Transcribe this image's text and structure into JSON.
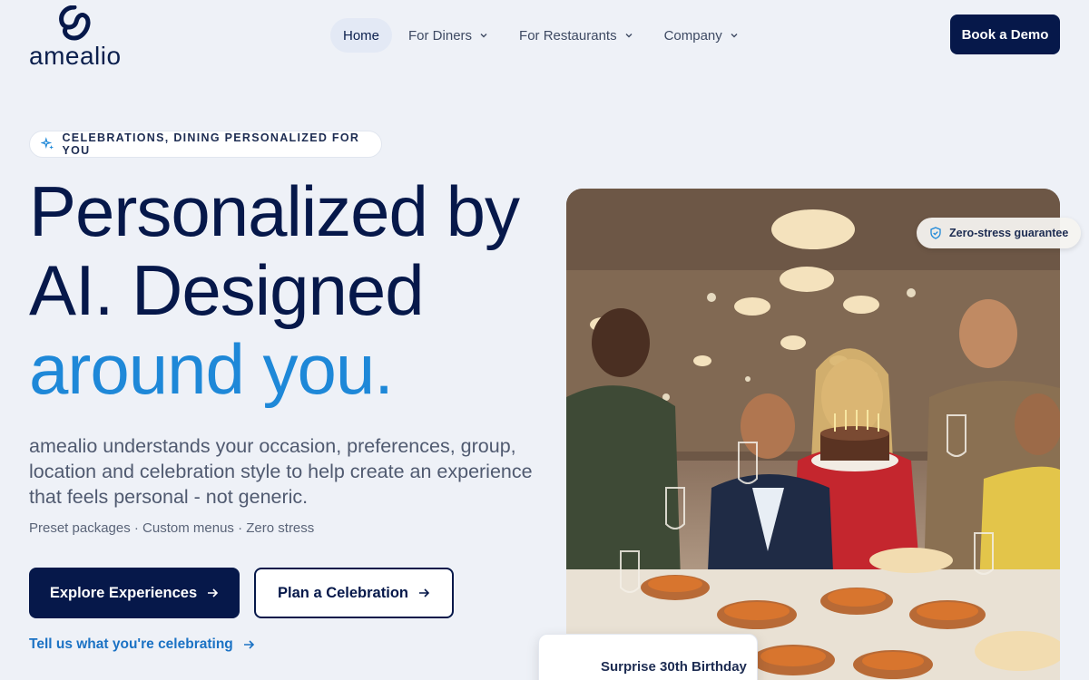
{
  "brand": {
    "name": "amealio"
  },
  "nav": {
    "items": [
      {
        "label": "Home",
        "active": true,
        "dropdown": false
      },
      {
        "label": "For Diners",
        "active": false,
        "dropdown": true
      },
      {
        "label": "For Restaurants",
        "active": false,
        "dropdown": true
      },
      {
        "label": "Company",
        "active": false,
        "dropdown": true
      }
    ],
    "cta_label": "Book a Demo"
  },
  "hero": {
    "badge": "CELEBRATIONS, DINING PERSONALIZED FOR YOU",
    "headline_line1": "Personalized by",
    "headline_line2": "AI. Designed",
    "headline_accent": "around you.",
    "description": "amealio understands your occasion, preferences, group, location and celebration style to help create an experience that feels personal - not generic.",
    "sub": "Preset packages · Custom menus · Zero stress",
    "primary_label": "Explore Experiences",
    "secondary_label": "Plan a Celebration",
    "link_label": "Tell us what you're celebrating"
  },
  "photo": {
    "guarantee_badge": "Zero-stress guarantee",
    "card_title": "Surprise 30th Birthday"
  },
  "colors": {
    "navy": "#06184a",
    "accent_blue": "#1e88d8",
    "link_blue": "#1b72c4",
    "background": "#eef1f7"
  },
  "icons": [
    "amealio-logo-icon",
    "chevron-down-icon",
    "sparkle-icon",
    "arrow-right-icon",
    "shield-check-icon"
  ]
}
